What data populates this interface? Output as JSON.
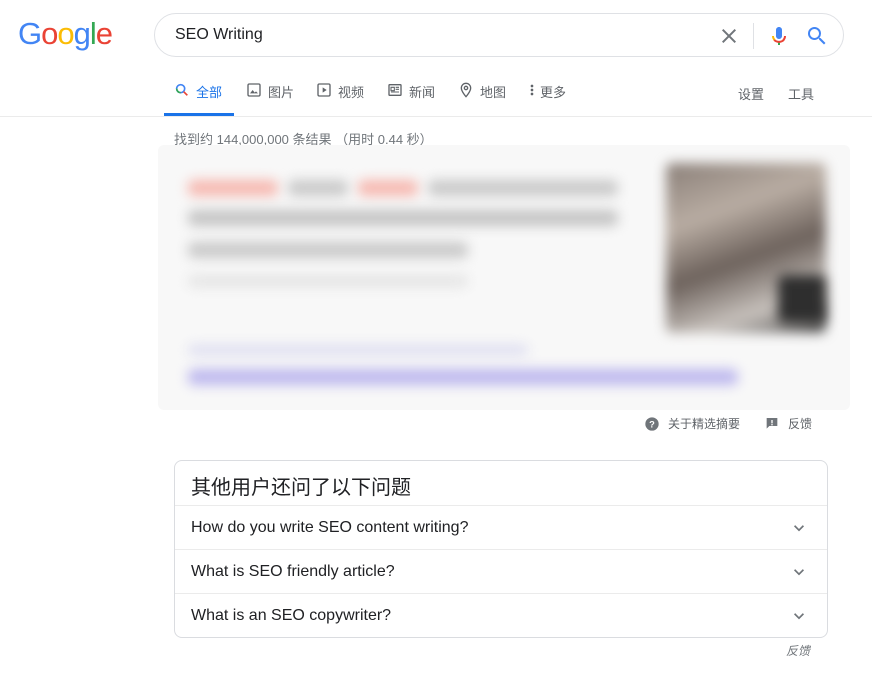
{
  "logo": {
    "letters": [
      "G",
      "o",
      "o",
      "g",
      "l",
      "e"
    ],
    "colors": [
      "#4285F4",
      "#EA4335",
      "#FBBC05",
      "#4285F4",
      "#34A853",
      "#EA4335"
    ]
  },
  "search": {
    "query": "SEO Writing",
    "icons": [
      "close-icon",
      "mic-icon",
      "search-icon"
    ]
  },
  "tabs": [
    {
      "label": "全部",
      "icon": "search-icon",
      "active": true
    },
    {
      "label": "图片",
      "icon": "image-icon"
    },
    {
      "label": "视频",
      "icon": "video-icon"
    },
    {
      "label": "新闻",
      "icon": "news-icon"
    },
    {
      "label": "地图",
      "icon": "map-pin-icon"
    },
    {
      "label": "更多",
      "icon": "more-vert-icon"
    }
  ],
  "tools": {
    "settings": "设置",
    "tools": "工具"
  },
  "stats": "找到约 144,000,000 条结果 （用时 0.44 秒）",
  "featured_snippet": {
    "about_label": "关于精选摘要",
    "feedback_label": "反馈"
  },
  "people_also_ask": {
    "title": "其他用户还问了以下问题",
    "questions": [
      "How do you write SEO content writing?",
      "What is SEO friendly article?",
      "What is an SEO copywriter?"
    ],
    "feedback": "反馈"
  },
  "colors": {
    "accent": "#1a73e8",
    "text_secondary": "#5f6368"
  }
}
